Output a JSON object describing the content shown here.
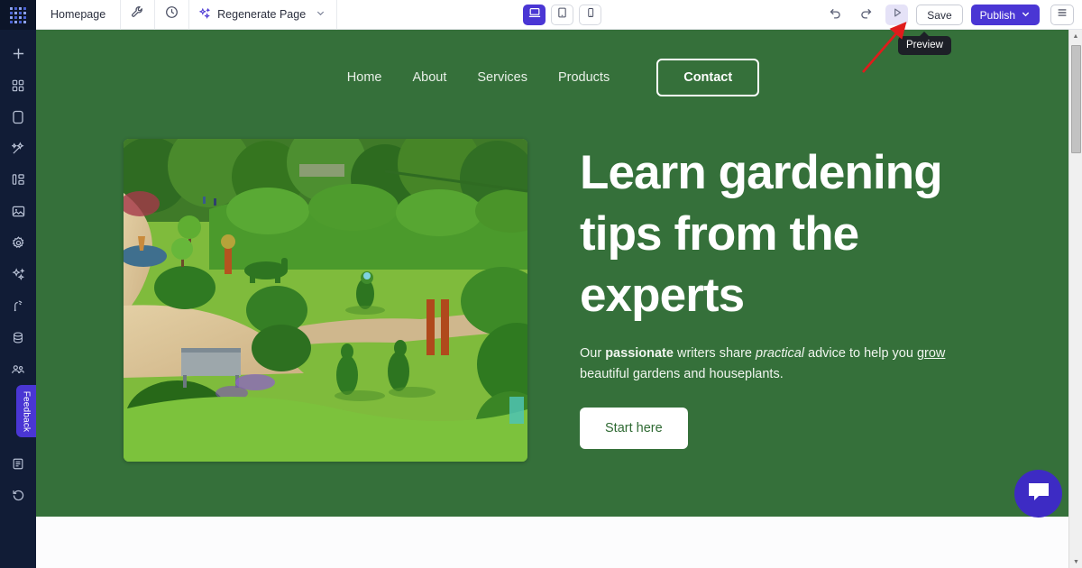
{
  "editor": {
    "logo_name": "app-logo",
    "page_label": "Homepage",
    "tool_icon": "wrench-icon",
    "history_icon": "clock-icon",
    "regenerate_label": "Regenerate Page",
    "regenerate_icon": "sparkles-icon",
    "regenerate_chevron": "chevron-down-icon",
    "devices": [
      {
        "name": "desktop",
        "icon": "desktop-icon",
        "active": true
      },
      {
        "name": "tablet",
        "icon": "tablet-icon",
        "active": false
      },
      {
        "name": "mobile",
        "icon": "mobile-icon",
        "active": false
      }
    ],
    "undo_icon": "undo-icon",
    "redo_icon": "redo-icon",
    "preview_icon": "play-triangle-icon",
    "save_label": "Save",
    "publish_label": "Publish",
    "publish_chevron": "chevron-down-icon",
    "menu_icon": "hamburger-menu-icon",
    "tooltip_label": "Preview",
    "annotation_arrow": "red-arrow-pointer"
  },
  "rail": {
    "items": [
      {
        "name": "add",
        "icon": "plus-icon"
      },
      {
        "name": "sections",
        "icon": "grid-blocks-icon"
      },
      {
        "name": "pages",
        "icon": "page-icon"
      },
      {
        "name": "design",
        "icon": "wand-icon"
      },
      {
        "name": "structure",
        "icon": "sitemap-icon"
      },
      {
        "name": "media",
        "icon": "image-icon"
      },
      {
        "name": "settings",
        "icon": "gear-icon"
      },
      {
        "name": "ai-tools",
        "icon": "sparkles-icon"
      },
      {
        "name": "seo",
        "icon": "signal-icon"
      },
      {
        "name": "database",
        "icon": "database-icon"
      },
      {
        "name": "members",
        "icon": "users-icon"
      }
    ],
    "feedback_label": "Feedback",
    "items_bottom": [
      {
        "name": "docs",
        "icon": "book-icon"
      },
      {
        "name": "restore",
        "icon": "history-restore-icon"
      }
    ]
  },
  "site": {
    "nav": [
      {
        "label": "Home"
      },
      {
        "label": "About"
      },
      {
        "label": "Services"
      },
      {
        "label": "Products"
      }
    ],
    "nav_cta": "Contact",
    "hero": {
      "title": "Learn gardening tips from the experts",
      "body_prefix": "Our ",
      "body_bold": "passionate",
      "body_mid1": " writers share ",
      "body_italic": "practical",
      "body_mid2": " advice to help you ",
      "body_underline": "grow",
      "body_suffix": " beautiful gardens and houseplants.",
      "cta_label": "Start here",
      "image_alt": "topiary-garden-photo"
    }
  },
  "widgets": {
    "chat_icon": "chat-bubble-icon"
  },
  "colors": {
    "hero_green": "#35703a",
    "brand_purple": "#4a36d4",
    "rail_navy": "#111c36",
    "annotation_red": "#e01b1b"
  },
  "scrollbar": {
    "up_arrow": "scroll-up-arrow",
    "down_arrow": "scroll-down-arrow"
  }
}
